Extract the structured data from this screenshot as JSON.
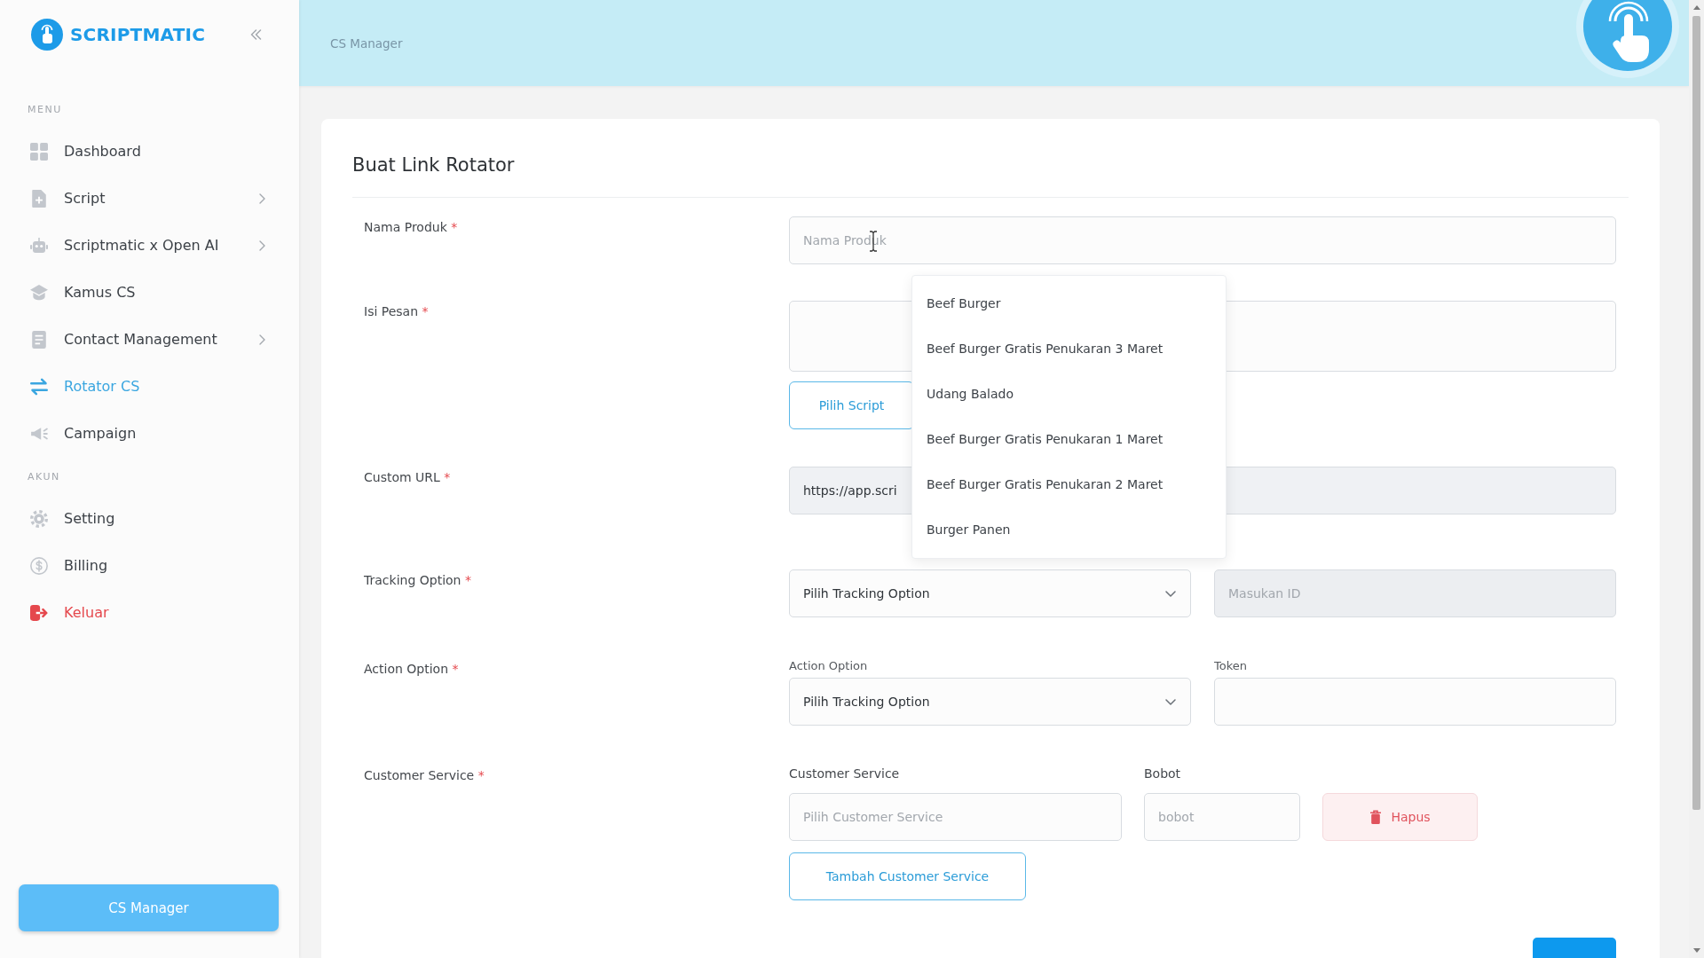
{
  "sidebar": {
    "logo": "SCRIPTMATIC",
    "sections": [
      {
        "heading": "MENU",
        "items": [
          {
            "label": "Dashboard",
            "kind": "normal",
            "selected": false,
            "has_submenu": false
          },
          {
            "label": "Script",
            "kind": "normal",
            "selected": false,
            "has_submenu": true
          },
          {
            "label": "Scriptmatic x Open AI",
            "kind": "normal",
            "selected": false,
            "has_submenu": true
          },
          {
            "label": "Kamus CS",
            "kind": "normal",
            "selected": false,
            "has_submenu": false
          },
          {
            "label": "Contact Management",
            "kind": "normal",
            "selected": false,
            "has_submenu": true
          },
          {
            "label": "Rotator CS",
            "kind": "normal",
            "selected": true,
            "has_submenu": false
          },
          {
            "label": "Campaign",
            "kind": "normal",
            "selected": false,
            "has_submenu": false
          }
        ]
      },
      {
        "heading": "AKUN",
        "items": [
          {
            "label": "Setting",
            "kind": "normal",
            "selected": false,
            "has_submenu": false
          },
          {
            "label": "Billing",
            "kind": "normal",
            "selected": false,
            "has_submenu": false
          },
          {
            "label": "Keluar",
            "kind": "danger",
            "selected": false,
            "has_submenu": false
          }
        ]
      }
    ],
    "footer_button": "CS Manager"
  },
  "header": {
    "breadcrumb": "CS Manager"
  },
  "form": {
    "title": "Buat Link Rotator",
    "rows": [
      {
        "kind": "text",
        "label": "Nama Produk",
        "required_mark": "*",
        "placeholder": "Nama Produk",
        "suggestions": [
          {
            "label": "Beef Burger",
            "selected": false
          },
          {
            "label": "Beef Burger Gratis Penukaran 3 Maret",
            "selected": false
          },
          {
            "label": "Udang Balado",
            "selected": false
          },
          {
            "label": "Beef Burger Gratis Penukaran 1 Maret",
            "selected": false
          },
          {
            "label": "Beef Burger Gratis Penukaran 2 Maret",
            "selected": false
          },
          {
            "label": "Burger Panen",
            "selected": false
          }
        ]
      },
      {
        "kind": "textarea",
        "label": "Isi Pesan",
        "required_mark": "*",
        "button": "Pilih Script"
      },
      {
        "kind": "url",
        "label": "Custom URL",
        "required_mark": "*",
        "value": "https://app.scri"
      },
      {
        "kind": "tracking",
        "label": "Tracking Option",
        "required_mark": "*",
        "select": "Pilih Tracking Option",
        "id_field": {
          "placeholder": "Masukan ID",
          "disabled": true
        }
      },
      {
        "kind": "action",
        "label": "Action Option",
        "required_mark": "*",
        "select_label": "Action Option",
        "select": "Pilih Tracking Option",
        "token_label": "Token"
      },
      {
        "kind": "customer_service",
        "label": "Customer Service",
        "required_mark": "*",
        "cs_label": "Customer Service",
        "bobot_label": "Bobot",
        "entries": [
          {
            "cs_placeholder": "Pilih Customer Service",
            "bobot_placeholder": "bobot",
            "delete_button": "Hapus"
          }
        ],
        "add_button": "Tambah Customer Service"
      }
    ]
  }
}
